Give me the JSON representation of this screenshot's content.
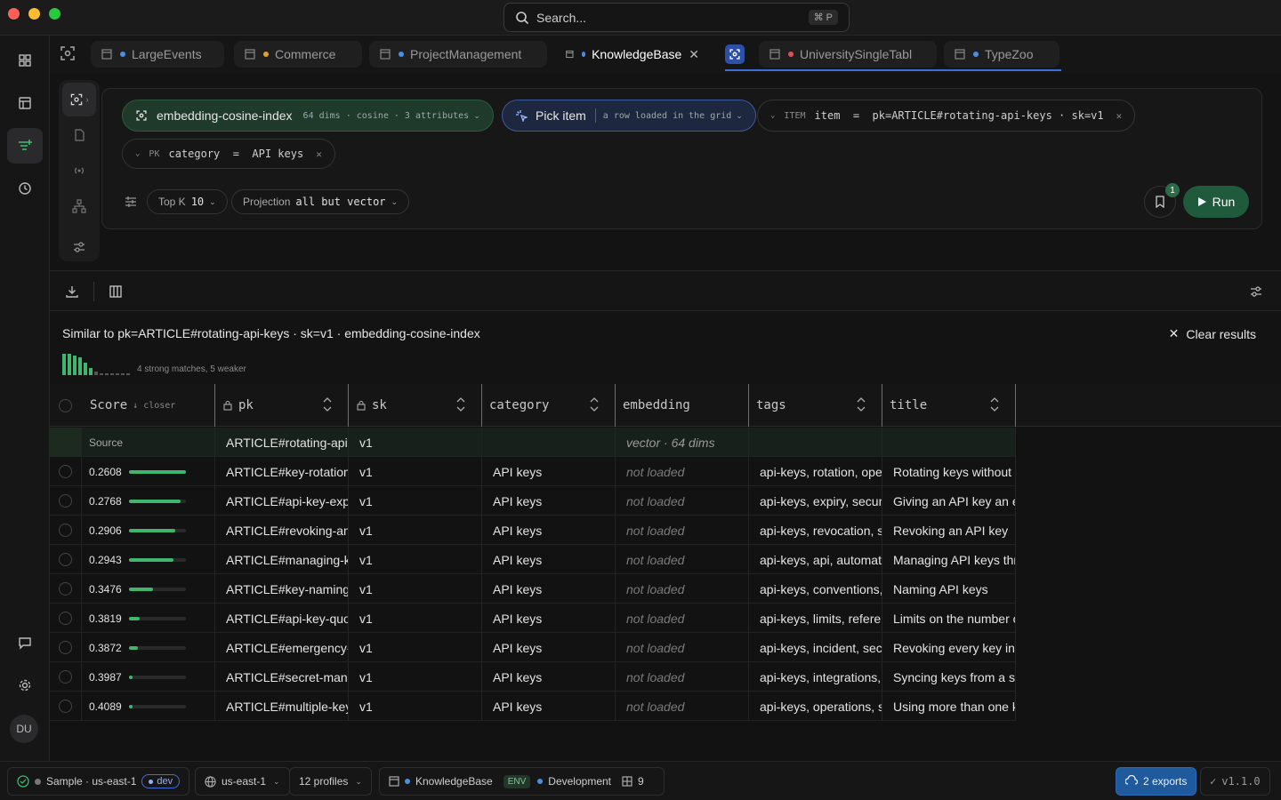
{
  "search": {
    "placeholder": "Search...",
    "shortcut": "⌘ P"
  },
  "rail": {
    "avatar": "DU"
  },
  "tabs": [
    {
      "label": "LargeEvents",
      "dot": "#4a90e2"
    },
    {
      "label": "Commerce",
      "dot": "#e0a030"
    },
    {
      "label": "ProjectManagement",
      "dot": "#4a90e2"
    },
    {
      "label": "KnowledgeBase",
      "dot": "#4a90e2"
    },
    {
      "label": "UniversitySingleTabl",
      "dot": "#e05050"
    },
    {
      "label": "TypeZoo",
      "dot": "#4a90e2"
    }
  ],
  "query": {
    "index": {
      "name": "embedding-cosine-index",
      "meta": "64 dims · cosine · 3 attributes"
    },
    "pick": {
      "label": "Pick item",
      "hint": "a row loaded in the grid"
    },
    "item": {
      "tag": "ITEM",
      "text": "item  =  pk=ARTICLE#rotating-api-keys · sk=v1"
    },
    "filter": {
      "tag": "PK",
      "text": "category  =  API keys"
    },
    "topk": {
      "label": "Top K",
      "value": "10"
    },
    "projection": {
      "label": "Projection",
      "value": "all but vector"
    },
    "run": "Run",
    "bookmark_count": "1"
  },
  "results": {
    "similar": "Similar to pk=ARTICLE#rotating-api-keys · sk=v1 · embedding-cosine-index",
    "clear": "Clear results",
    "note": "4 strong matches, 5 weaker",
    "histogram": [
      1,
      1,
      0.9,
      0.85,
      0.6,
      0.35,
      0.15,
      0.08,
      0.08,
      0.08,
      0.08,
      0.08,
      0.08
    ]
  },
  "table": {
    "columns": [
      {
        "label": "Score",
        "sub": "↓ closer"
      },
      {
        "label": "pk"
      },
      {
        "label": "sk"
      },
      {
        "label": "category"
      },
      {
        "label": "embedding"
      },
      {
        "label": "tags"
      },
      {
        "label": "title"
      }
    ],
    "source": {
      "label": "Source",
      "pk": "ARTICLE#rotating-api-keys",
      "sk": "v1",
      "embedding": "vector · 64 dims"
    },
    "rows": [
      {
        "score": "0.2608",
        "fill": 1.0,
        "pk": "ARTICLE#key-rotation",
        "sk": "v1",
        "category": "API keys",
        "embedding": "not loaded",
        "tags": "api-keys, rotation, operations",
        "title": "Rotating keys without downtime"
      },
      {
        "score": "0.2768",
        "fill": 0.9,
        "pk": "ARTICLE#api-key-expiry",
        "sk": "v1",
        "category": "API keys",
        "embedding": "not loaded",
        "tags": "api-keys, expiry, security",
        "title": "Giving an API key an expiry"
      },
      {
        "score": "0.2906",
        "fill": 0.82,
        "pk": "ARTICLE#revoking-an-api-key",
        "sk": "v1",
        "category": "API keys",
        "embedding": "not loaded",
        "tags": "api-keys, revocation, security",
        "title": "Revoking an API key"
      },
      {
        "score": "0.2943",
        "fill": 0.78,
        "pk": "ARTICLE#managing-keys",
        "sk": "v1",
        "category": "API keys",
        "embedding": "not loaded",
        "tags": "api-keys, api, automation",
        "title": "Managing API keys through the API"
      },
      {
        "score": "0.3476",
        "fill": 0.42,
        "pk": "ARTICLE#key-naming",
        "sk": "v1",
        "category": "API keys",
        "embedding": "not loaded",
        "tags": "api-keys, conventions, naming",
        "title": "Naming API keys"
      },
      {
        "score": "0.3819",
        "fill": 0.18,
        "pk": "ARTICLE#api-key-quotas",
        "sk": "v1",
        "category": "API keys",
        "embedding": "not loaded",
        "tags": "api-keys, limits, reference",
        "title": "Limits on the number of keys"
      },
      {
        "score": "0.3872",
        "fill": 0.15,
        "pk": "ARTICLE#emergency-revocation",
        "sk": "v1",
        "category": "API keys",
        "embedding": "not loaded",
        "tags": "api-keys, incident, security",
        "title": "Revoking every key in an emergency"
      },
      {
        "score": "0.3987",
        "fill": 0.06,
        "pk": "ARTICLE#secret-managers",
        "sk": "v1",
        "category": "API keys",
        "embedding": "not loaded",
        "tags": "api-keys, integrations, secrets",
        "title": "Syncing keys from a secret manager"
      },
      {
        "score": "0.4089",
        "fill": 0.0,
        "pk": "ARTICLE#multiple-keys",
        "sk": "v1",
        "category": "API keys",
        "embedding": "not loaded",
        "tags": "api-keys, operations, setup",
        "title": "Using more than one key"
      }
    ]
  },
  "status": {
    "connection": "Sample · us-east-1",
    "dev": "dev",
    "region": "us-east-1",
    "profiles": "12 profiles",
    "table": "KnowledgeBase",
    "env_tag": "ENV",
    "env": "Development",
    "count": "9",
    "exports": "2 exports",
    "version": "v1.1.0"
  }
}
